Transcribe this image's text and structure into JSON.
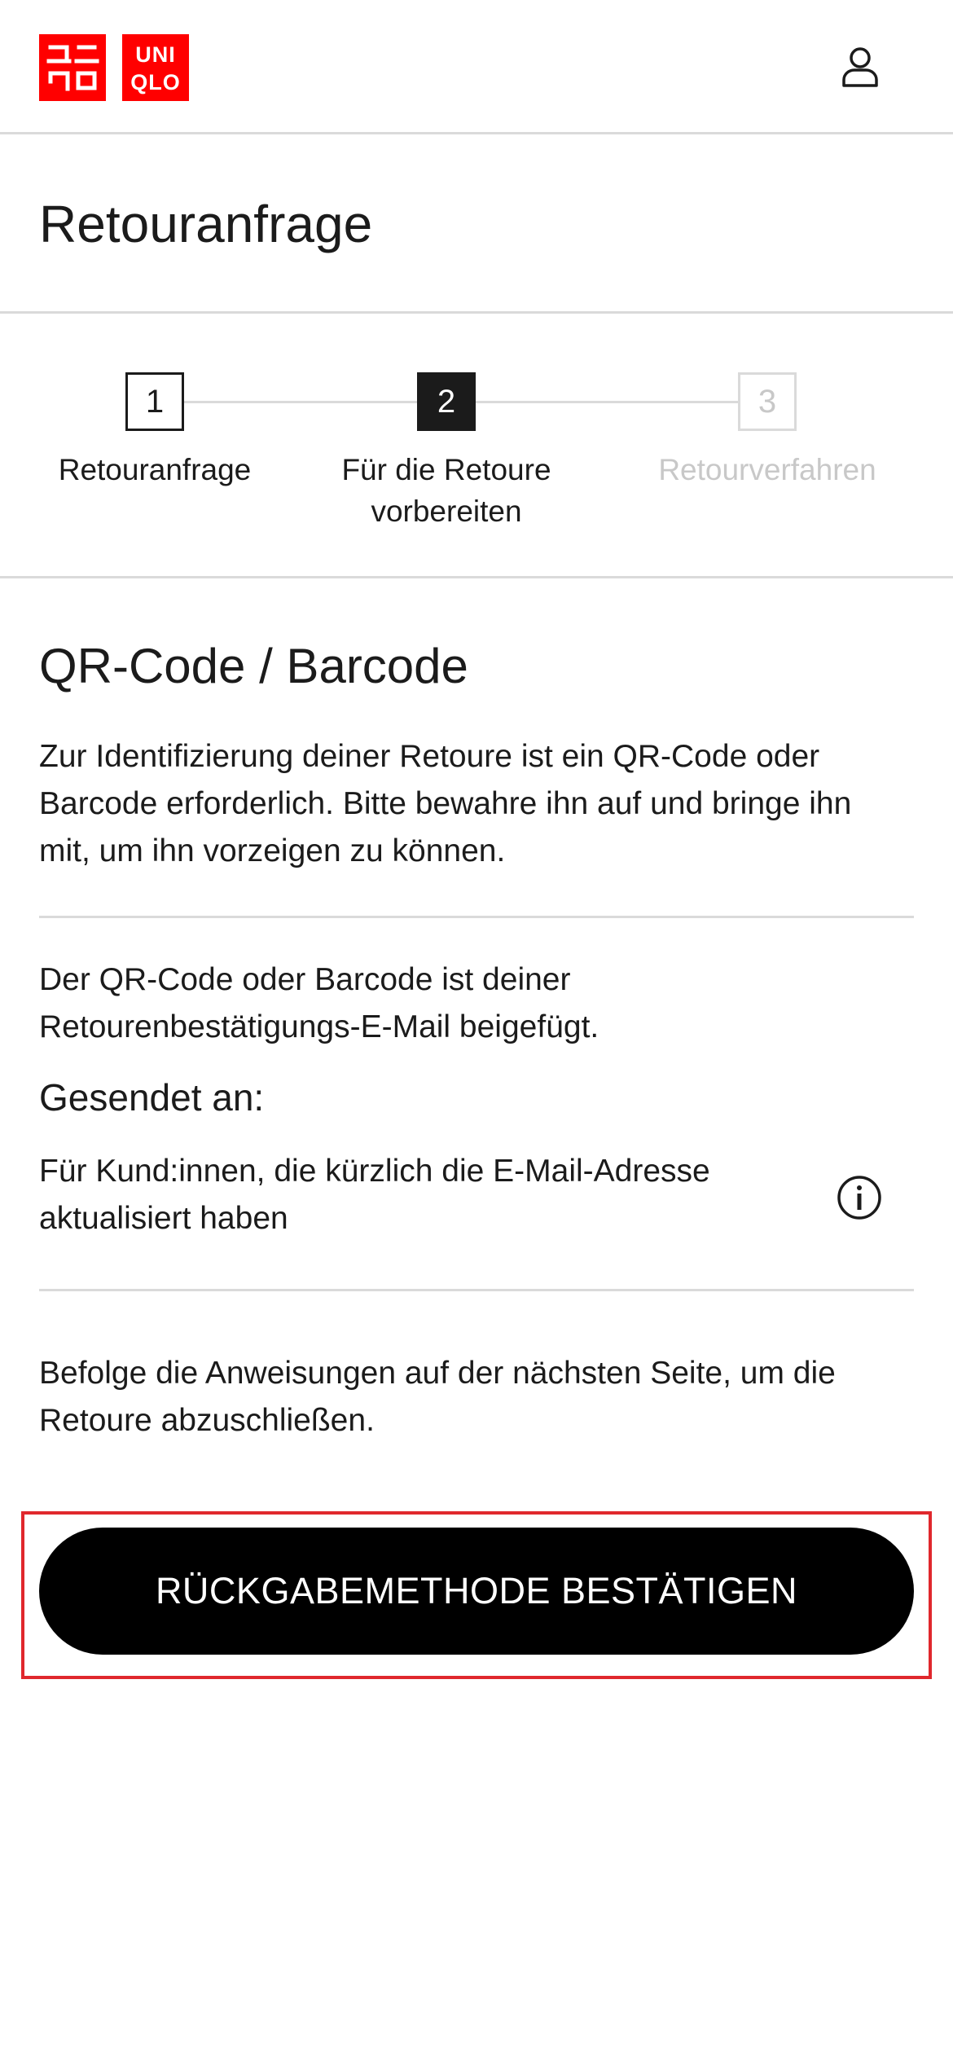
{
  "header": {
    "logo_left": [
      "ユニ",
      "クロ"
    ],
    "logo_right": [
      "UNI",
      "QLO"
    ],
    "brand_color": "#ff0000",
    "account_icon": "user-icon"
  },
  "page": {
    "title": "Retouranfrage"
  },
  "stepper": {
    "steps": [
      {
        "number": "1",
        "label": "Retouranfrage",
        "state": "done"
      },
      {
        "number": "2",
        "label_line1": "Für die Retoure",
        "label_line2": "vorbereiten",
        "state": "active"
      },
      {
        "number": "3",
        "label": "Retourverfahren",
        "state": "pending"
      }
    ]
  },
  "section": {
    "title": "QR-Code / Barcode",
    "intro_line1": "Zur Identifizierung deiner Retoure ist ein QR-Code oder",
    "intro_line2": "Barcode erforderlich. Bitte bewahre ihn auf und bringe ihn",
    "intro_line3": "mit, um ihn vorzeigen zu können.",
    "attached_line1": "Der QR-Code oder Barcode ist deiner",
    "attached_line2": "Retourenbestätigungs-E-Mail beigefügt.",
    "sent_to_label": "Gesendet an:",
    "updated_email_line1": "Für Kund:innen, die kürzlich die E-Mail-Adresse",
    "updated_email_line2": "aktualisiert haben",
    "info_icon": "info-icon",
    "follow_line1": "Befolge die Anweisungen auf der nächsten Seite, um die",
    "follow_line2": "Retoure abzuschließen."
  },
  "cta": {
    "label": "RÜCKGABEMETHODE BESTÄTIGEN",
    "background": "#000000",
    "highlight_color": "#e0282d"
  }
}
